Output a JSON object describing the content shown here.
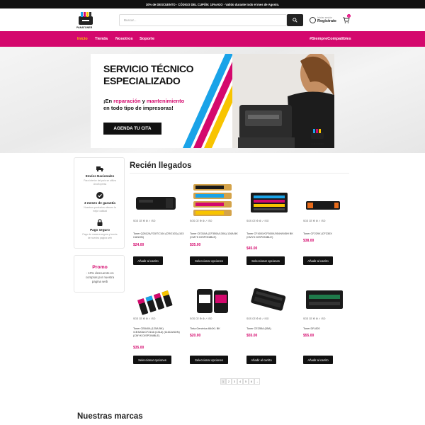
{
  "topbar": {
    "text": "10% de DESCUENTO - CÓDIGO DEL CUPÓN: 10%AGO - Valido durante todo el mes de Agosto."
  },
  "header": {
    "logo_text": "PANATONER",
    "search_placeholder": "Buscar...",
    "user_small": "Iniciar sesión",
    "user_register": "Registrate",
    "cart_count": "0"
  },
  "nav": {
    "items": [
      "Inicio",
      "Tienda",
      "Nosotros",
      "Soporte"
    ],
    "hashtag": "#SiempreCompatibles"
  },
  "hero": {
    "title1": "SERVICIO TÉCNICO",
    "title2": "ESPECIALIZADO",
    "sub_a": "¡En ",
    "sub_b": "reparación",
    "sub_c": " y ",
    "sub_d": "mantenimiento",
    "sub2": "en todo tipo de impresoras!",
    "button": "AGENDA TU CITA",
    "brand": "PANATONER"
  },
  "sidebar": {
    "items": [
      {
        "icon": "truck-icon",
        "title": "Envíos Nacionales",
        "text": "Para interior del país se utiliza UnoExpress"
      },
      {
        "icon": "check-circle-icon",
        "title": "3 meses de garantía",
        "text": "Nuestros productos ofrecen la mejor calidad"
      },
      {
        "icon": "lock-icon",
        "title": "Pago seguro",
        "text": "Pago de manera segura y través de nuestra pagina web"
      }
    ],
    "promo_title": "Promo",
    "promo_text": "- 10% descuento en compras por nuestra pagina web"
  },
  "section_title": "Recién llegados",
  "certs": "SGS CE ♻ ⚙ ✓ ISO",
  "products": [
    {
      "title": "Toner Q2612A/703/TC104 (CRG103) (103 CANON)",
      "price": "$24.00",
      "button": "Añadir al carrito"
    },
    {
      "title": "Toner CE310A (CF350A/130A) 126A BK (CMYK DISPONIBLE)",
      "price": "$35.00",
      "button": "Seleccionar opciones"
    },
    {
      "title": "Toner CF400X/CF500X/054H/045H BK (CMYK DISPONIBLE)",
      "price": "$45.00",
      "button": "Seleccionar opciones"
    },
    {
      "title": "Toner CF229X (CF230X",
      "price": "$38.00",
      "button": "Añadir al carrito"
    },
    {
      "title": "Toner CB540A (125A BK) /CE320A/CF210A (131A) (116CANON) (CMYK DISPONIBLE)",
      "price": "$35.00",
      "button": "Seleccionar opciones"
    },
    {
      "title": "Tinta Genérica 664XL BK",
      "price": "$20.00",
      "button": "Seleccionar opciones"
    },
    {
      "title": "Toner CE255A (55A)",
      "price": "$55.00",
      "button": "Añadir al carrito"
    },
    {
      "title": "Toner DR-820",
      "price": "$55.00",
      "button": "Añadir al carrito"
    }
  ],
  "pagination": [
    "1",
    "2",
    "3",
    "4",
    "5",
    "6",
    "→"
  ],
  "brands_title": "Nuestras marcas"
}
